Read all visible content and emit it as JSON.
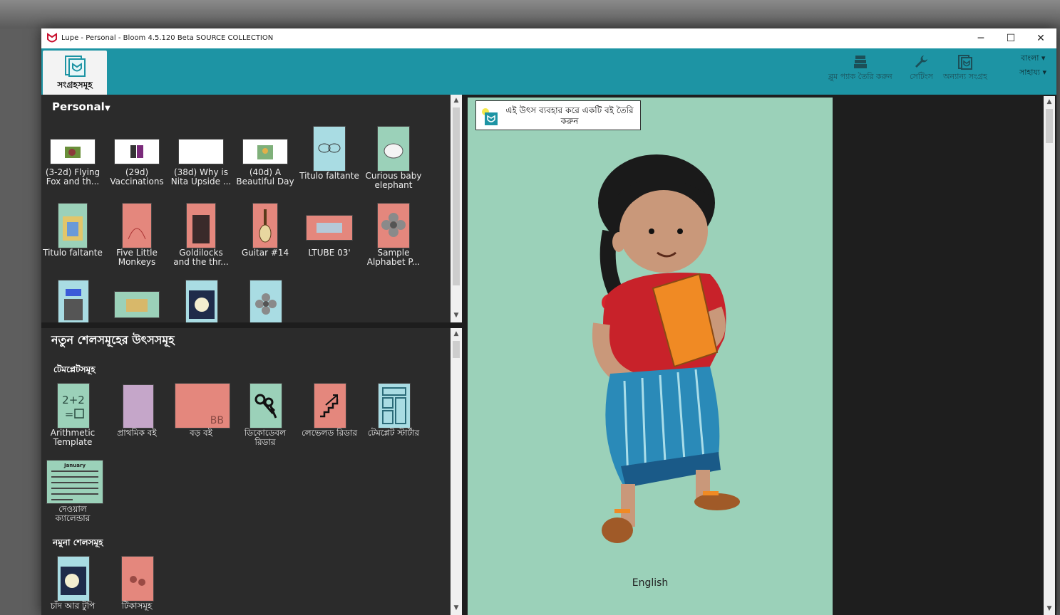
{
  "window": {
    "title": "Lupe - Personal - Bloom 4.5.120 Beta SOURCE COLLECTION",
    "controls": [
      "─",
      "☐",
      "✕"
    ]
  },
  "toolbar": {
    "collections_tab": "সংগ্রহসমূহ",
    "make_bloompack": "ব্লুম প্যাক তৈরি করুন",
    "settings": "সেটিংস",
    "other_collection": "অন্যান্য সংগ্রহ",
    "language_menu": "বাংলা ▾",
    "help_menu": "সাহায্য ▾",
    "accent_color": "#1d94a4"
  },
  "collection": {
    "title": "Personal",
    "books": [
      {
        "label": "(3-2d) Flying Fox and th...",
        "color": "#ffffff"
      },
      {
        "label": "(29d) Vaccinations",
        "color": "#ffffff"
      },
      {
        "label": "(38d) Why is Nita Upside ...",
        "color": "#ffffff"
      },
      {
        "label": "(40d) A Beautiful Day",
        "color": "#ffffff"
      },
      {
        "label": "Titulo faltante",
        "color": "#a9dce3"
      },
      {
        "label": "Curious  baby elephant",
        "color": "#9bd1b9"
      },
      {
        "label": "Titulo faltante",
        "color": "#9bd1b9"
      },
      {
        "label": "Five Little Monkeys",
        "color": "#e4877d"
      },
      {
        "label": "Goldilocks and the thr...",
        "color": "#e4877d"
      },
      {
        "label": "Guitar #14",
        "color": "#e4877d"
      },
      {
        "label": "LTUBE 03'",
        "color": "#e4877d"
      },
      {
        "label": "Sample Alphabet P...",
        "color": "#e4877d"
      },
      {
        "label": "",
        "color": "#a9dce3"
      },
      {
        "label": "",
        "color": "#9bd1b9"
      },
      {
        "label": "",
        "color": "#a9dce3"
      },
      {
        "label": "",
        "color": "#a9dce3"
      }
    ]
  },
  "sources": {
    "title": "নতুন শেলসমূহের উৎসসমূহ",
    "templates_title": "টেমপ্লেটসমূহ",
    "templates": [
      {
        "label": "Arithmetic Template",
        "color": "#9bd1b9",
        "glyph": "2+2\n=☐"
      },
      {
        "label": "প্রাথমিক বই",
        "color": "#c5a6c9",
        "glyph": ""
      },
      {
        "label": "বড় বই",
        "color": "#e4877d",
        "glyph": "BB"
      },
      {
        "label": "ডিকোডেবল রিডার",
        "color": "#9bd1b9",
        "glyph": "key-icon"
      },
      {
        "label": "লেভেলড রিডার",
        "color": "#e4877d",
        "glyph": "stairs-icon"
      },
      {
        "label": "টেমপ্লেট স্টার্টার",
        "color": "#a9dce3",
        "glyph": "layout-icon"
      },
      {
        "label": "দেওয়াল ক্যালেন্ডার",
        "color": "#9bd1b9",
        "glyph": "January"
      }
    ],
    "samples_title": "নমুনা শেলসমূহ",
    "samples": [
      {
        "label": "চাঁদ আর টুপি",
        "color": "#a9dce3"
      },
      {
        "label": "টিকাসমূহ",
        "color": "#e4877d"
      }
    ]
  },
  "preview": {
    "make_book_button": "এই উৎস ব্যবহার করে একটি বই তৈরি করুন",
    "page_language": "English",
    "page_color": "#9bd1b9"
  }
}
